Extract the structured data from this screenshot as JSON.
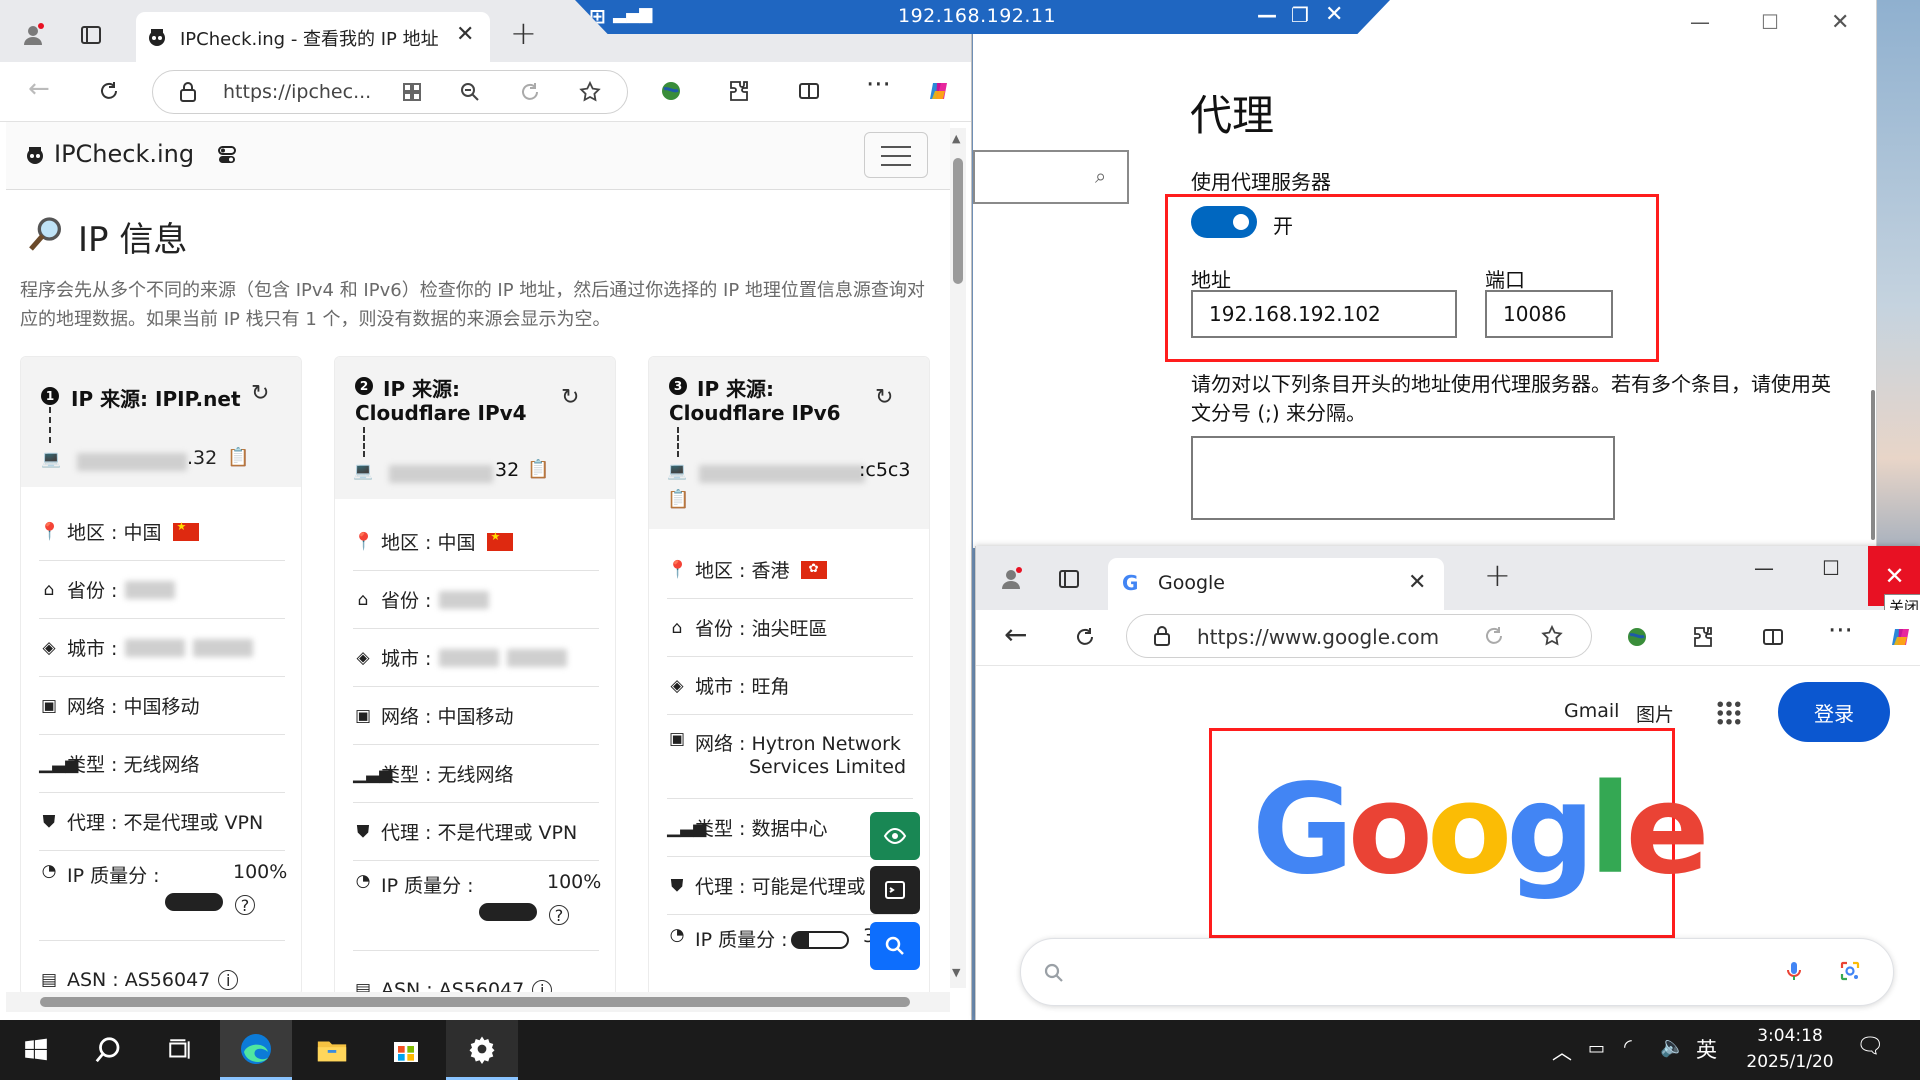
{
  "browser_left": {
    "tab_title": "IPCheck.ing - 查看我的 IP 地址 - I",
    "url": "https://ipchec...",
    "site_name": "IPCheck.ing",
    "page_heading": "IP 信息",
    "description": "程序会先从多个不同的来源（包含 IPv4 和 IPv6）检查你的 IP 地址，然后通过你选择的 IP 地理位置信息源查询对应的地理数据。如果当前 IP 栈只有 1 个，则没有数据的来源会显示为空。",
    "cards": [
      {
        "num": "1",
        "title": "IP 来源: IPIP.net",
        "ip_suffix": ".32",
        "rows": [
          "地区 : 中国",
          "省份 :",
          "城市 :",
          "网络 : 中国移动",
          "类型 : 无线网络",
          "代理 : 不是代理或 VPN",
          "IP 质量分 :",
          "ASN : AS56047"
        ],
        "score": "100%"
      },
      {
        "num": "2",
        "title": "IP 来源:",
        "title2": "Cloudflare IPv4",
        "ip_suffix": "32",
        "rows": [
          "地区 : 中国",
          "省份 :",
          "城市 :",
          "网络 : 中国移动",
          "类型 : 无线网络",
          "代理 : 不是代理或 VPN",
          "IP 质量分 :",
          "ASN : AS56047"
        ],
        "score": "100%"
      },
      {
        "num": "3",
        "title": "IP 来源:",
        "title2": "Cloudflare IPv6",
        "ip_suffix": ":c5c3",
        "rows": [
          "地区 : 香港",
          "省份 : 油尖旺區",
          "城市 : 旺角",
          "网络 : Hytron Network",
          "类型 : 数据中心",
          "代理 : 可能是代理或",
          "IP 质量分 :"
        ],
        "rows_extra": "Services Limited",
        "score": "3"
      }
    ]
  },
  "settings": {
    "rdp_title": "192.168.192.11",
    "heading": "代理",
    "use_proxy_label": "使用代理服务器",
    "toggle_state": "开",
    "address_label": "地址",
    "address_value": "192.168.192.102",
    "port_label": "端口",
    "port_value": "10086",
    "exceptions_text": "请勿对以下列条目开头的地址使用代理服务器。若有多个条目，请使用英文分号 (;) 来分隔。"
  },
  "browser_google": {
    "tab_title": "Google",
    "url": "https://www.google.com",
    "close_tooltip": "关闭",
    "gmail": "Gmail",
    "images": "图片",
    "signin": "登录",
    "logo": "Google"
  },
  "taskbar": {
    "ime": "英",
    "time": "3:04:18",
    "date": "2025/1/20"
  },
  "colors": {
    "toggle_on": "#0067c0",
    "highlight_red": "#ff1d1d",
    "google_blue": "#4285f4",
    "google_red": "#ea4335",
    "google_yellow": "#fbbc05",
    "google_green": "#34a853",
    "signin_bg": "#0b57d0"
  }
}
